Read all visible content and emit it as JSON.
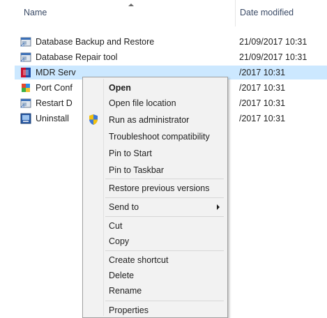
{
  "columns": {
    "name": "Name",
    "date_modified": "Date modified"
  },
  "files": [
    {
      "name": "Database Backup and Restore",
      "date": "21/09/2017 10:31",
      "icon": "app-shortcut-icon"
    },
    {
      "name": "Database Repair tool",
      "date": "21/09/2017 10:31",
      "icon": "app-shortcut-icon"
    },
    {
      "name": "MDR Serv",
      "date": "/2017 10:31",
      "icon": "app-shortcut-icon",
      "selected": true
    },
    {
      "name": "Port Conf",
      "date": "/2017 10:31",
      "icon": "app-shortcut-icon"
    },
    {
      "name": "Restart D",
      "date": "/2017 10:31",
      "icon": "app-shortcut-icon"
    },
    {
      "name": "Uninstall",
      "date": "/2017 10:31",
      "icon": "app-shortcut-icon"
    }
  ],
  "context_menu": {
    "open": "Open",
    "open_file_location": "Open file location",
    "run_as_administrator": "Run as administrator",
    "troubleshoot_compatibility": "Troubleshoot compatibility",
    "pin_to_start": "Pin to Start",
    "pin_to_taskbar": "Pin to Taskbar",
    "restore_previous_versions": "Restore previous versions",
    "send_to": "Send to",
    "cut": "Cut",
    "copy": "Copy",
    "create_shortcut": "Create shortcut",
    "delete": "Delete",
    "rename": "Rename",
    "properties": "Properties"
  },
  "colors": {
    "selection": "#cce8ff",
    "menu_background": "#f2f2f2",
    "header_text": "#3a4a66"
  }
}
